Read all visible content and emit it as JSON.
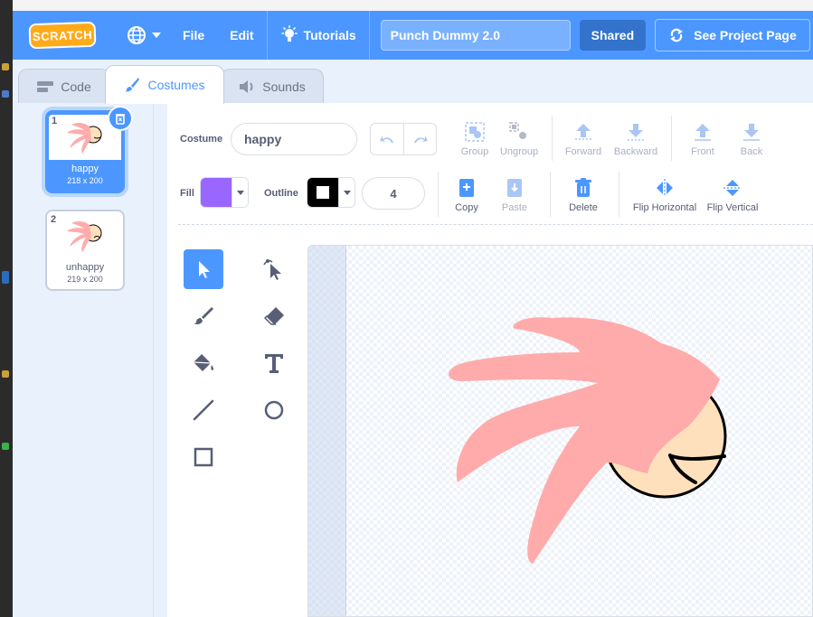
{
  "menubar": {
    "logo_text": "SCRATCH",
    "file_label": "File",
    "edit_label": "Edit",
    "tutorials_label": "Tutorials",
    "project_title": "Punch Dummy 2.0",
    "shared_label": "Shared",
    "see_project_label": "See Project Page"
  },
  "tabs": [
    {
      "label": "Code",
      "icon": "code-blocks-icon"
    },
    {
      "label": "Costumes",
      "icon": "paintbrush-icon",
      "active": true
    },
    {
      "label": "Sounds",
      "icon": "speaker-icon"
    }
  ],
  "costumes": [
    {
      "number": "1",
      "name": "happy",
      "size": "218 x 200",
      "selected": true
    },
    {
      "number": "2",
      "name": "unhappy",
      "size": "219 x 200",
      "selected": false
    }
  ],
  "editor": {
    "costume_label": "Costume",
    "costume_name": "happy",
    "fill_label": "Fill",
    "outline_label": "Outline",
    "outline_width": "4",
    "fill_color": "#9966ff",
    "outline_color": "#000000",
    "actions": {
      "group": "Group",
      "ungroup": "Ungroup",
      "forward": "Forward",
      "backward": "Backward",
      "front": "Front",
      "back": "Back",
      "copy": "Copy",
      "paste": "Paste",
      "delete": "Delete",
      "flip_horizontal": "Flip Horizontal",
      "flip_vertical": "Flip Vertical"
    }
  },
  "tools": [
    "select",
    "reshape",
    "brush",
    "eraser",
    "fill",
    "text",
    "line",
    "circle",
    "rectangle"
  ],
  "colors": {
    "menubar": "#4c97ff",
    "accent": "#4c97ff",
    "hair_pink": "#ffabab",
    "face": "#ffe0bd"
  }
}
